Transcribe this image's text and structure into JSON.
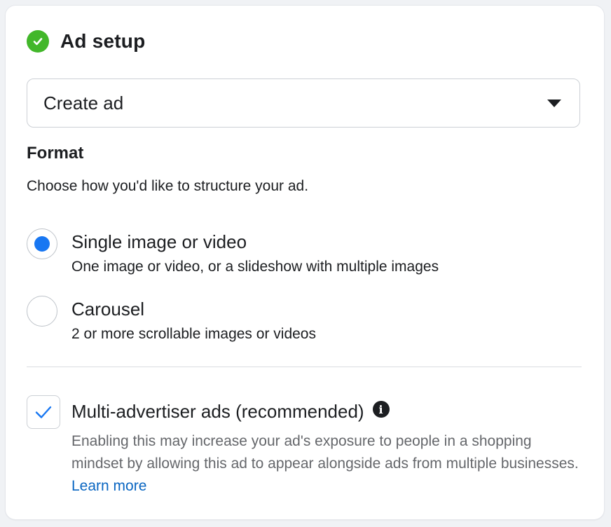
{
  "header": {
    "title": "Ad setup",
    "status_icon": "check-circle-icon",
    "status_color": "#42b72a"
  },
  "ad_select": {
    "value": "Create ad",
    "icon": "caret-down-icon"
  },
  "format": {
    "heading": "Format",
    "description": "Choose how you'd like to structure your ad.",
    "options": [
      {
        "title": "Single image or video",
        "subtitle": "One image or video, or a slideshow with multiple images",
        "selected": true
      },
      {
        "title": "Carousel",
        "subtitle": "2 or more scrollable images or videos",
        "selected": false
      }
    ]
  },
  "multi_advertiser": {
    "checked": true,
    "title": "Multi-advertiser ads (recommended)",
    "info_icon": "info-icon",
    "description": "Enabling this may increase your ad's exposure to people in a shopping mindset by allowing this ad to appear alongside ads from multiple businesses.",
    "link_text": "Learn more"
  },
  "colors": {
    "accent": "#1877f2",
    "link": "#0a66c2",
    "muted_text": "#65676b"
  }
}
